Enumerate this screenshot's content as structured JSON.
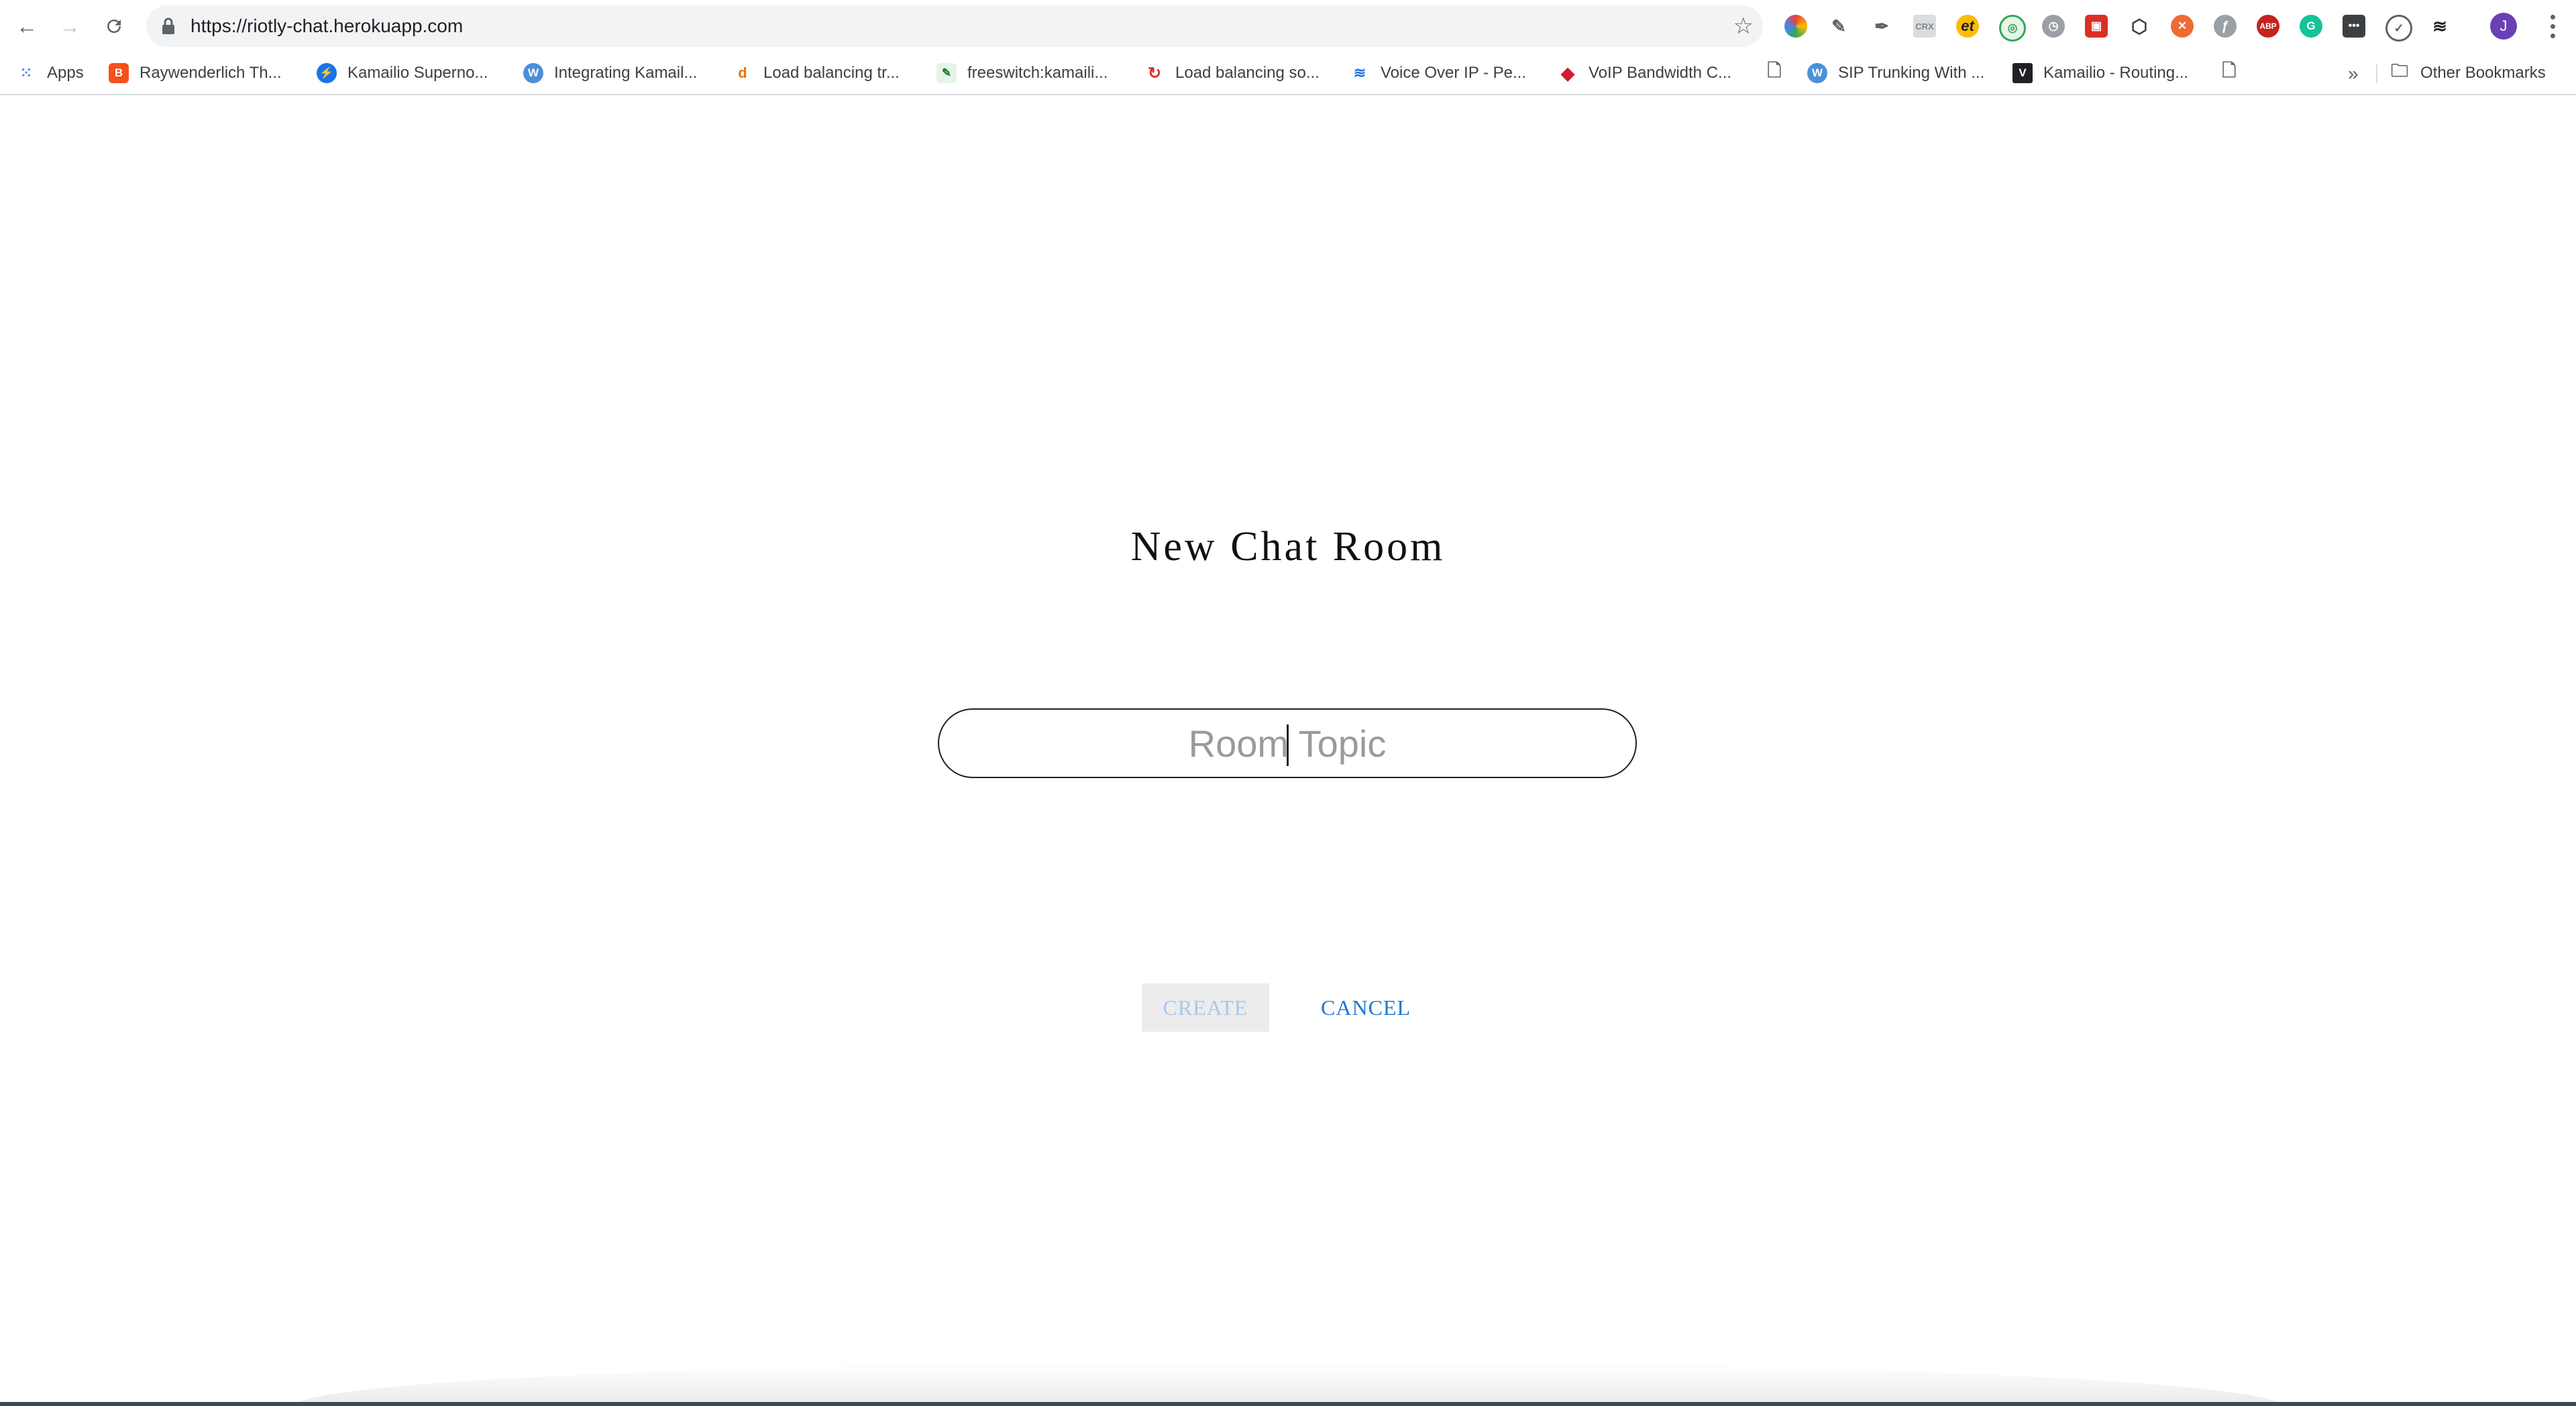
{
  "browser": {
    "url": "https://riotly-chat.herokuapp.com",
    "profile_initial": "J",
    "bookmarks": [
      {
        "label": "Apps",
        "color": "#ea4335",
        "glyph": "⋮⋮"
      },
      {
        "label": "Raywenderlich Th...",
        "color": "#f4511e",
        "glyph": "B"
      },
      {
        "label": "Kamailio Superno...",
        "color": "#1a73e8",
        "glyph": "⚡"
      },
      {
        "label": "Integrating Kamail...",
        "color": "#4a90d9",
        "glyph": "W"
      },
      {
        "label": "Load balancing tr...",
        "color": "#ffffff",
        "glyph": "d"
      },
      {
        "label": "freeswitch:kamaili...",
        "color": "#e8eaed",
        "glyph": "✎"
      },
      {
        "label": "Load balancing so...",
        "color": "#ffffff",
        "glyph": "↻"
      },
      {
        "label": "Voice Over IP - Pe...",
        "color": "#ffffff",
        "glyph": "≋"
      },
      {
        "label": "VoIP Bandwidth C...",
        "color": "#d01c2c",
        "glyph": "◆"
      },
      {
        "label": "",
        "color": "#ffffff",
        "glyph": "🗋"
      },
      {
        "label": "SIP Trunking With ...",
        "color": "#4a90d9",
        "glyph": "W"
      },
      {
        "label": "Kamailio - Routing...",
        "color": "#202124",
        "glyph": "V"
      },
      {
        "label": "",
        "color": "#ffffff",
        "glyph": "🗋"
      }
    ],
    "overflow": "»",
    "other_bookmarks": "Other Bookmarks"
  },
  "page": {
    "title": "New Chat Room",
    "topic_placeholder": "Room Topic",
    "topic_value": "",
    "create_label": "CREATE",
    "cancel_label": "CANCEL"
  },
  "colors": {
    "accent": "#1e78d2",
    "create_disabled_text": "#a8c8ec",
    "create_disabled_bg": "#ececec"
  }
}
